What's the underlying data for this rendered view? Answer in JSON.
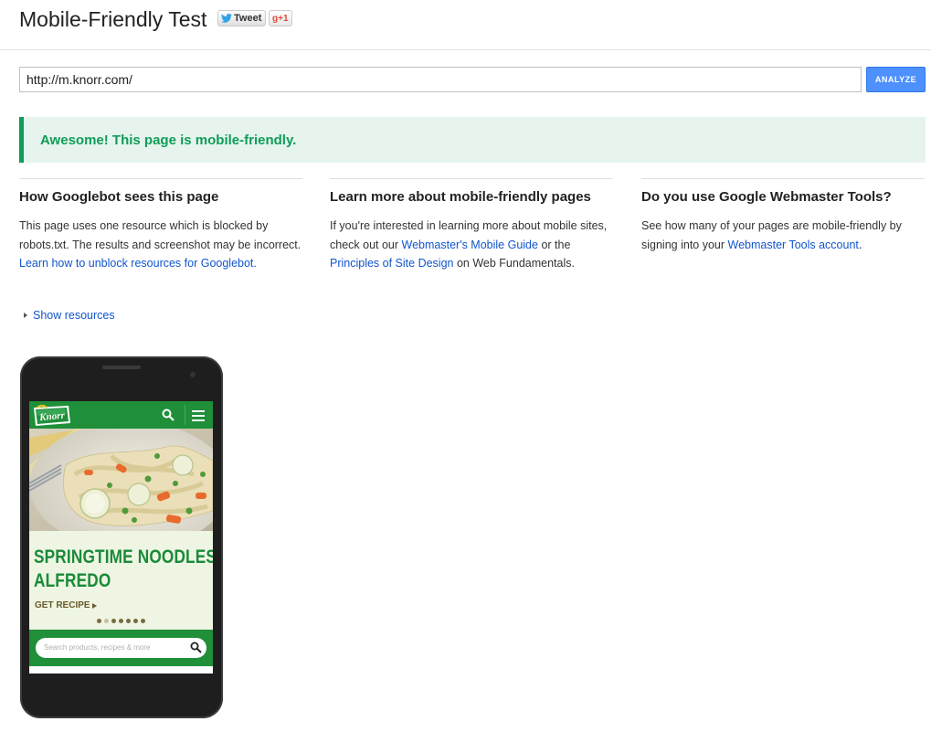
{
  "header": {
    "title": "Mobile-Friendly Test",
    "tweet_label": "Tweet",
    "gplus_label": "g+1"
  },
  "form": {
    "url_value": "http://m.knorr.com/",
    "analyze_label": "ANALYZE"
  },
  "result": {
    "message": "Awesome! This page is mobile-friendly.",
    "status_color": "#0f9d58"
  },
  "columns": [
    {
      "heading": "How Googlebot sees this page",
      "text_1": "This page uses one resource which is blocked by robots.txt. The results and screenshot may be incorrect. ",
      "link_1": "Learn how to unblock resources for Googlebot."
    },
    {
      "heading": "Learn more about mobile-friendly pages",
      "text_1": "If you're interested in learning more about mobile sites, check out our ",
      "link_1": "Webmaster's Mobile Guide",
      "text_2": " or the ",
      "link_2": "Principles of Site Design",
      "text_3": " on Web Fundamentals."
    },
    {
      "heading": "Do you use Google Webmaster Tools?",
      "text_1": "See how many of your pages are mobile-friendly by signing into your ",
      "link_1": "Webmaster Tools account",
      "text_2": "."
    }
  ],
  "show_resources_label": "Show resources",
  "phone_preview": {
    "logo_text": "Knorr",
    "hero_line_1": "SPRINGTIME NOODLES",
    "hero_line_2": "ALFREDO",
    "cta_label": "GET RECIPE",
    "carousel_dots": 7,
    "active_dot": 1,
    "search_placeholder": "Search products, recipes & more",
    "brand_green": "#1f8f3a"
  },
  "colors": {
    "link": "#1155cc",
    "button_blue": "#4d90fe",
    "banner_bg": "#e6f4ed"
  }
}
